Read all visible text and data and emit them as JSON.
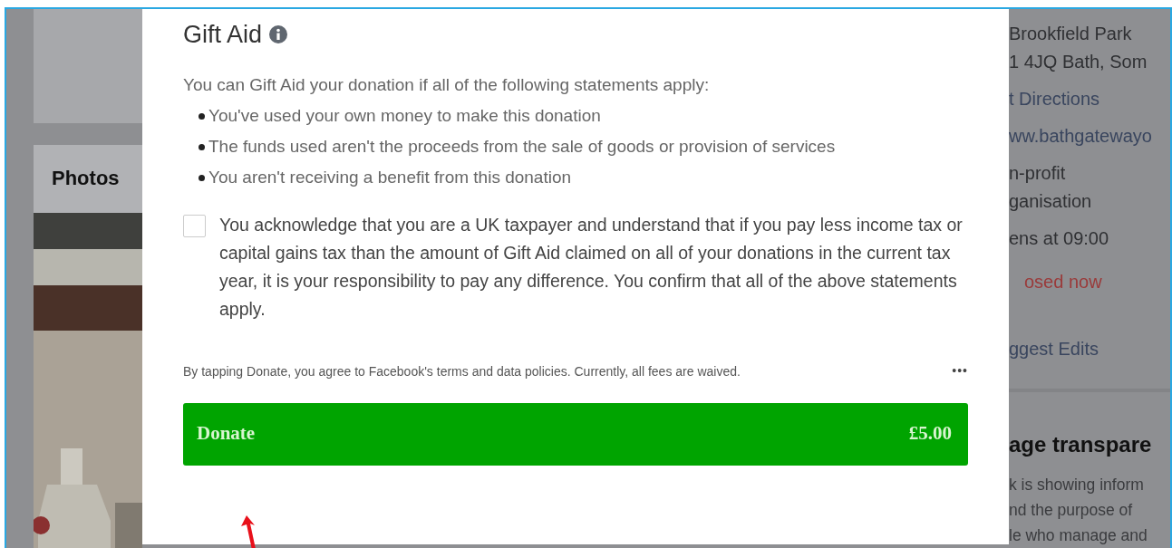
{
  "background": {
    "photos_heading": "Photos",
    "details": [
      {
        "kind": "text",
        "text": "Brookfield Park"
      },
      {
        "kind": "text",
        "text": "1 4JQ Bath, Som"
      },
      {
        "kind": "link",
        "text": "t Directions"
      },
      {
        "kind": "link",
        "text": "ww.bathgatewayo"
      },
      {
        "kind": "text",
        "text": "n-profit"
      },
      {
        "kind": "text",
        "text": "ganisation"
      },
      {
        "kind": "text",
        "text": "ens at 09:00"
      },
      {
        "kind": "alert",
        "text": "osed now"
      },
      {
        "kind": "link",
        "text": "ggest Edits"
      }
    ],
    "transparency": {
      "heading": "age transpare",
      "lines": [
        "k is showing inform",
        "nd the purpose of",
        "le who manage and"
      ]
    }
  },
  "modal": {
    "title": "Gift Aid",
    "intro": "You can Gift Aid your donation if all of the following statements apply:",
    "bullets": [
      {
        "text": "You've used your own money to make this donation"
      },
      {
        "text": "The funds used aren't the proceeds from the sale of goods or provision of services"
      },
      {
        "text": "You aren't receiving a benefit from this donation"
      }
    ],
    "acknowledgement": {
      "checked": false,
      "label": "You acknowledge that you are a UK taxpayer and understand that if you pay less income tax or capital gains tax than the amount of Gift Aid claimed on all of your donations in the current tax year, it is your responsibility to pay any difference. You confirm that all of the above statements apply."
    },
    "terms": "By tapping Donate, you agree to Facebook's terms and data policies. Currently, all fees are waived.",
    "more": "•••",
    "donate": {
      "label": "Donate",
      "amount": "£5.00"
    }
  }
}
